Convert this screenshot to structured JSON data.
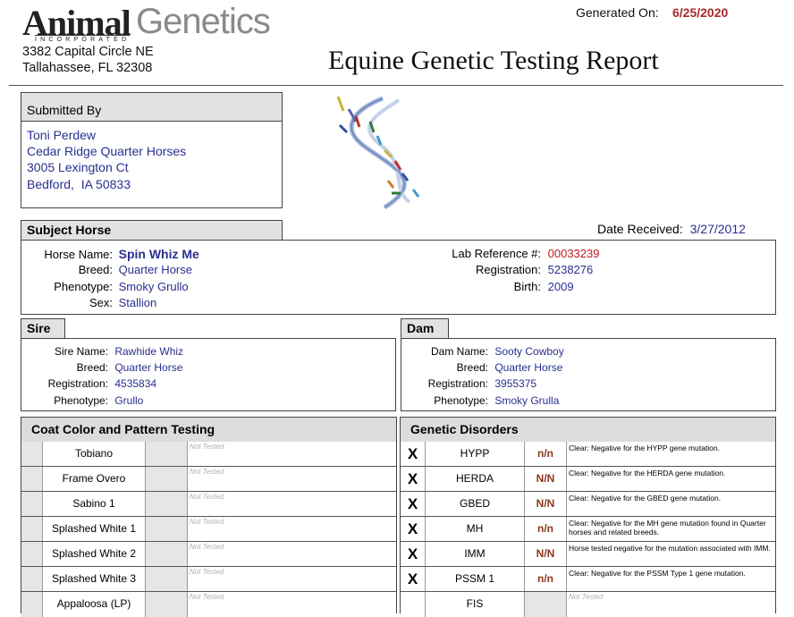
{
  "company": {
    "logo_main": "Animal",
    "logo_sub": "Genetics",
    "logo_inc": "INCORPORATED",
    "address1": "3382 Capital Circle NE",
    "address2": "Tallahassee, FL 32308"
  },
  "generated": {
    "label": "Generated On:",
    "date": "6/25/2020"
  },
  "report_title": "Equine Genetic Testing Report",
  "submitted_by": {
    "header": "Submitted By",
    "lines": [
      "Toni Perdew",
      "Cedar Ridge Quarter Horses",
      "3005 Lexington Ct",
      "Bedford,  IA 50833"
    ]
  },
  "date_received": {
    "label": "Date Received:",
    "value": "3/27/2012"
  },
  "subject": {
    "header": "Subject Horse",
    "left": [
      {
        "label": "Horse Name:",
        "value": "Spin Whiz Me"
      },
      {
        "label": "Breed:",
        "value": "Quarter Horse"
      },
      {
        "label": "Phenotype:",
        "value": "Smoky Grullo"
      },
      {
        "label": "Sex:",
        "value": "Stallion"
      }
    ],
    "right": [
      {
        "label": "Lab Reference #:",
        "value": "00033239"
      },
      {
        "label": "Registration:",
        "value": "5238276"
      },
      {
        "label": "Birth:",
        "value": "2009"
      }
    ]
  },
  "sire": {
    "header": "Sire",
    "rows": [
      {
        "label": "Sire Name:",
        "value": "Rawhide Whiz"
      },
      {
        "label": "Breed:",
        "value": "Quarter Horse"
      },
      {
        "label": "Registration:",
        "value": "4535834"
      },
      {
        "label": "Phenotype:",
        "value": "Grullo"
      }
    ]
  },
  "dam": {
    "header": "Dam",
    "rows": [
      {
        "label": "Dam Name:",
        "value": "Sooty Cowboy"
      },
      {
        "label": "Breed:",
        "value": "Quarter Horse"
      },
      {
        "label": "Registration:",
        "value": "3955375"
      },
      {
        "label": "Phenotype:",
        "value": "Smoky Grulla"
      }
    ]
  },
  "coat": {
    "header": "Coat Color and Pattern Testing",
    "rows": [
      {
        "name": "Tobiano",
        "status": "Not Tested"
      },
      {
        "name": "Frame Overo",
        "status": "Not Tested"
      },
      {
        "name": "Sabino 1",
        "status": "Not Tested"
      },
      {
        "name": "Splashed White 1",
        "status": "Not Tested"
      },
      {
        "name": "Splashed White 2",
        "status": "Not Tested"
      },
      {
        "name": "Splashed White 3",
        "status": "Not Tested"
      },
      {
        "name": "Appaloosa (LP)",
        "status": "Not Tested"
      }
    ]
  },
  "disorders": {
    "header": "Genetic Disorders",
    "rows": [
      {
        "mark": "X",
        "name": "HYPP",
        "result": "n/n",
        "desc": "Clear: Negative for the HYPP gene mutation."
      },
      {
        "mark": "X",
        "name": "HERDA",
        "result": "N/N",
        "desc": "Clear: Negative for the HERDA gene mutation."
      },
      {
        "mark": "X",
        "name": "GBED",
        "result": "N/N",
        "desc": "Clear: Negative for the GBED gene mutation."
      },
      {
        "mark": "X",
        "name": "MH",
        "result": "n/n",
        "desc": "Clear: Negative for the MH gene mutation found in Quarter horses and related breeds."
      },
      {
        "mark": "X",
        "name": "IMM",
        "result": "N/N",
        "desc": "Horse tested negative for the mutation associated with IMM."
      },
      {
        "mark": "X",
        "name": "PSSM 1",
        "result": "n/n",
        "desc": "Clear: Negative for the PSSM Type 1 gene mutation."
      },
      {
        "mark": "",
        "name": "FIS",
        "result": "",
        "desc": "Not Tested"
      }
    ]
  },
  "colors": {
    "value_blue": "#2a2f8f",
    "ref_red": "#c0191f",
    "result_brown": "#8a3a1e",
    "header_gray": "#dcdcdc"
  }
}
